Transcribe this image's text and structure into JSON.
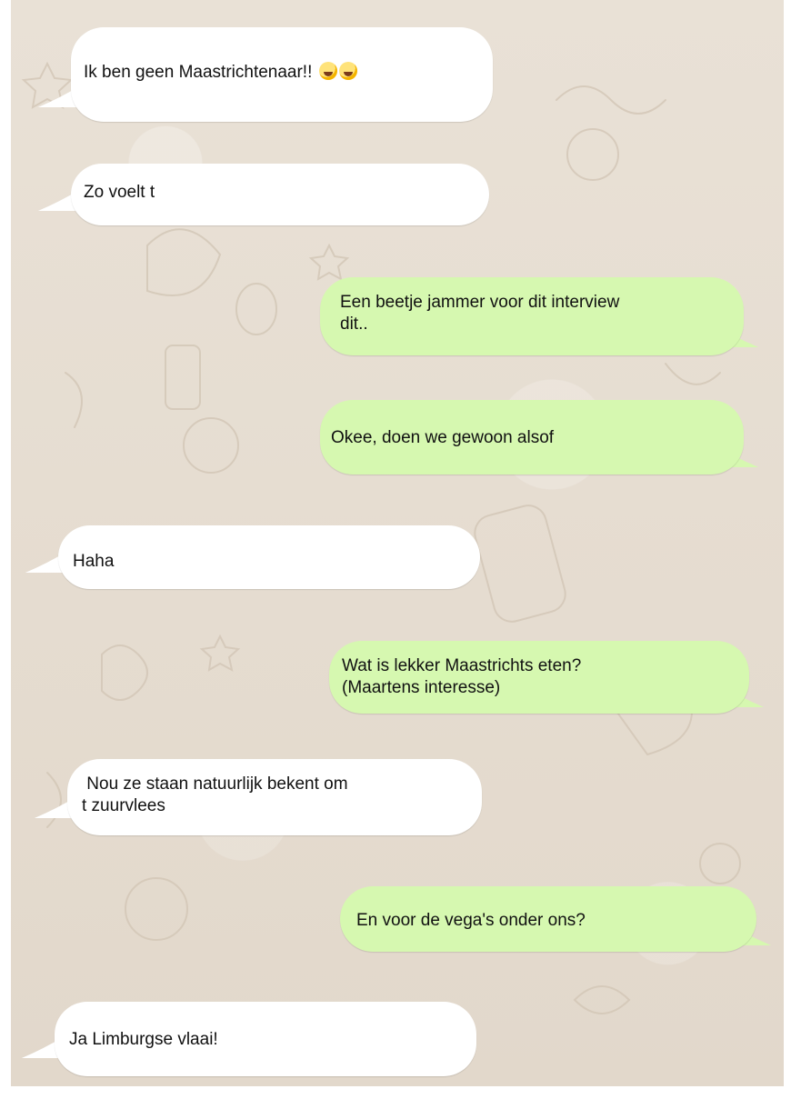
{
  "messages": [
    {
      "direction": "incoming",
      "text": "Ik ben geen Maastrichtenaar!!",
      "emojis": [
        "rolling-on-floor-laughing-emoji",
        "tears-of-joy-emoji"
      ]
    },
    {
      "direction": "incoming",
      "text": "Zo voelt t"
    },
    {
      "direction": "outgoing",
      "text": "Een beetje jammer voor dit interview\ndit.."
    },
    {
      "direction": "outgoing",
      "text": "Okee, doen we gewoon alsof"
    },
    {
      "direction": "incoming",
      "text": "Haha"
    },
    {
      "direction": "outgoing",
      "text": "Wat is lekker Maastrichts eten?\n(Maartens interesse)"
    },
    {
      "direction": "incoming",
      "text": " Nou ze staan natuurlijk bekent om\nt zuurvlees"
    },
    {
      "direction": "outgoing",
      "text": "En voor de vega's onder ons?"
    },
    {
      "direction": "incoming",
      "text": "Ja Limburgse vlaai!"
    }
  ],
  "colors": {
    "incoming_bubble": "#ffffff",
    "outgoing_bubble": "#d6f8b0",
    "background": "#e6ddd0"
  }
}
